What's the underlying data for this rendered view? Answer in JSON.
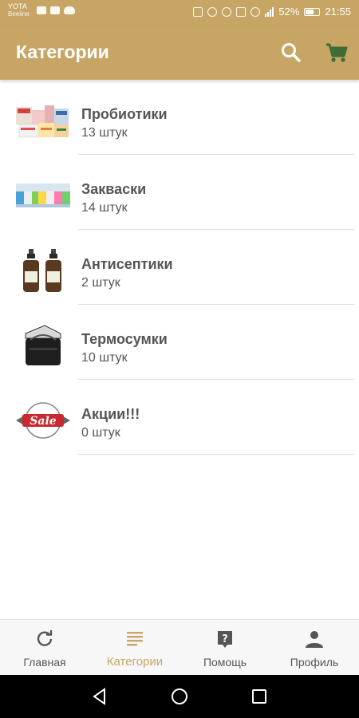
{
  "status_bar": {
    "carrier_name": "YOTA",
    "carrier_sub": "Beeline",
    "battery_percent": "52%",
    "time": "21:55"
  },
  "toolbar": {
    "title": "Категории",
    "search_icon": "search-icon",
    "cart_icon": "cart-icon"
  },
  "categories": [
    {
      "name": "Пробиотики",
      "count": "13 штук",
      "icon": "probiotics-image"
    },
    {
      "name": "Закваски",
      "count": "14 штук",
      "icon": "starter-cultures-image"
    },
    {
      "name": "Антисептики",
      "count": "2 штук",
      "icon": "antiseptic-bottles-image"
    },
    {
      "name": "Термосумки",
      "count": "10 штук",
      "icon": "thermo-bag-image"
    },
    {
      "name": "Акции!!!",
      "count": "0 штук",
      "icon": "sale-badge-image",
      "badge_text": "Sale"
    }
  ],
  "bottom_nav": {
    "items": [
      {
        "label": "Главная",
        "icon": "refresh-icon"
      },
      {
        "label": "Категории",
        "icon": "list-icon",
        "active": true
      },
      {
        "label": "Помощь",
        "icon": "help-icon"
      },
      {
        "label": "Профиль",
        "icon": "person-icon"
      }
    ]
  },
  "colors": {
    "accent": "#c7a665",
    "text": "#555555",
    "divider": "#dedede",
    "nav_background": "#f7f7f7",
    "cart_green": "#3f6b35"
  }
}
